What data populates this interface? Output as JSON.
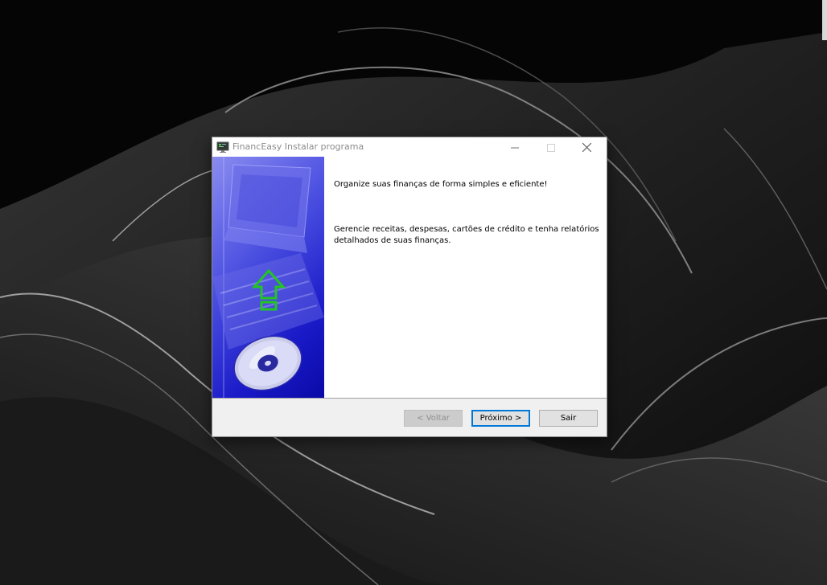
{
  "window": {
    "title": "FinancEasy Instalar programa",
    "controls": {
      "minimize_icon": "minimize-icon",
      "maximize_icon": "maximize-icon",
      "close_icon": "close-icon"
    }
  },
  "wizard": {
    "heading": "Organize suas finanças de forma simples e eficiente!",
    "description": "Gerencie receitas, despesas, cartões de crédito e tenha relatórios detalhados de suas finanças."
  },
  "buttons": {
    "back_label": "< Voltar",
    "next_label": "Próximo >",
    "exit_label": "Sair"
  },
  "colors": {
    "side_panel_blue": "#1a1ac8",
    "arrow_green": "#22c522",
    "focus_border": "#0078d7",
    "titlebar": "#ffffff"
  }
}
